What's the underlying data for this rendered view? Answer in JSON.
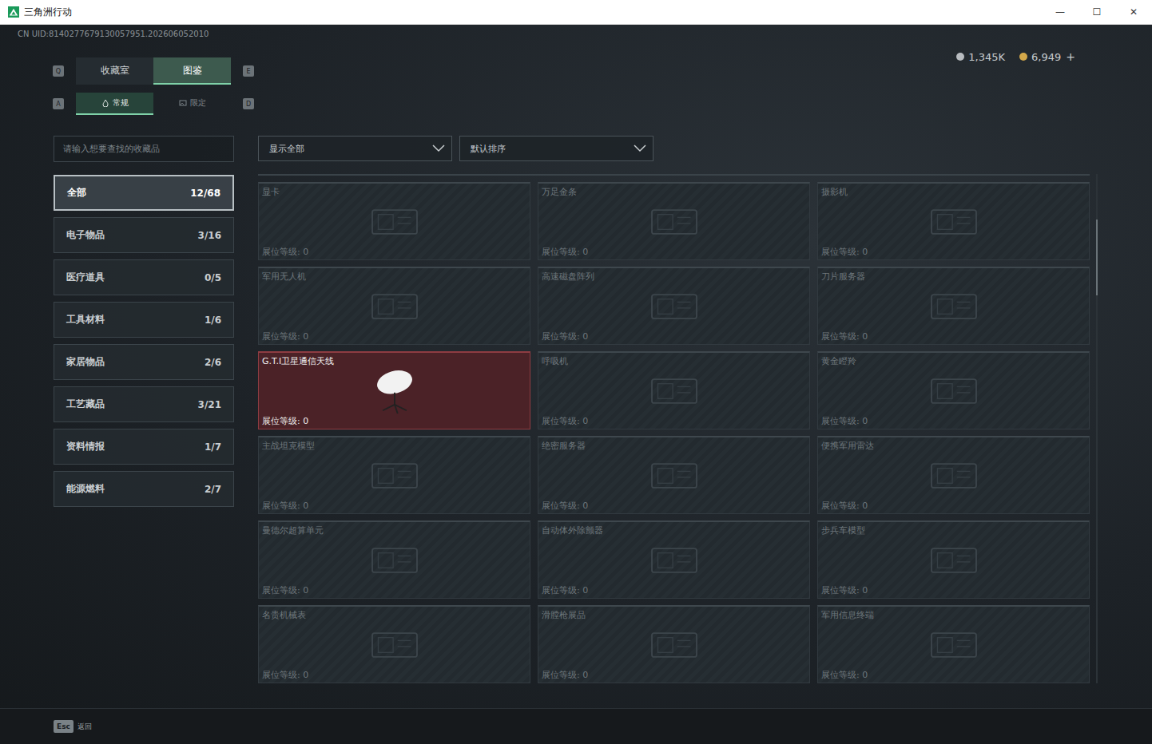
{
  "window": {
    "title": "三角洲行动",
    "controls": [
      "—",
      "☐",
      "✕"
    ]
  },
  "uid": "CN UID:8140277679130057951.202606052010",
  "currencies": [
    {
      "amount": "1,345K",
      "color": "#b8bcc0"
    },
    {
      "amount": "6,949",
      "color": "#d4a84a"
    }
  ],
  "add_button": "+",
  "main_tabs": {
    "prev_key": "Q",
    "next_key": "E",
    "items": [
      {
        "label": "收藏室",
        "selected": false
      },
      {
        "label": "图鉴",
        "selected": true
      }
    ]
  },
  "sub_tabs": {
    "prev_key": "A",
    "next_key": "D",
    "items": [
      {
        "label": "常规",
        "selected": true
      },
      {
        "label": "限定",
        "selected": false
      }
    ]
  },
  "search": {
    "placeholder": "请输入想要查找的收藏品"
  },
  "filters": [
    {
      "value": "显示全部"
    },
    {
      "value": "默认排序"
    }
  ],
  "categories": [
    {
      "label": "全部",
      "count": "12/68",
      "selected": true
    },
    {
      "label": "电子物品",
      "count": "3/16",
      "selected": false
    },
    {
      "label": "医疗道具",
      "count": "0/5",
      "selected": false
    },
    {
      "label": "工具材料",
      "count": "1/6",
      "selected": false
    },
    {
      "label": "家居物品",
      "count": "2/6",
      "selected": false
    },
    {
      "label": "工艺藏品",
      "count": "3/21",
      "selected": false
    },
    {
      "label": "资料情报",
      "count": "1/7",
      "selected": false
    },
    {
      "label": "能源燃料",
      "count": "2/7",
      "selected": false
    }
  ],
  "items": [
    {
      "name": "显卡",
      "level_text": "展位等级: 0",
      "owned": false
    },
    {
      "name": "万足金条",
      "level_text": "展位等级: 0",
      "owned": false
    },
    {
      "name": "摄影机",
      "level_text": "展位等级: 0",
      "owned": false
    },
    {
      "name": "军用无人机",
      "level_text": "展位等级: 0",
      "owned": false
    },
    {
      "name": "高速磁盘阵列",
      "level_text": "展位等级: 0",
      "owned": false
    },
    {
      "name": "刀片服务器",
      "level_text": "展位等级: 0",
      "owned": false
    },
    {
      "name": "G.T.I卫星通信天线",
      "level_text": "展位等级: 0",
      "owned": true
    },
    {
      "name": "呼吸机",
      "level_text": "展位等级: 0",
      "owned": false
    },
    {
      "name": "黄金瞪羚",
      "level_text": "展位等级: 0",
      "owned": false
    },
    {
      "name": "主战坦克模型",
      "level_text": "展位等级: 0",
      "owned": false
    },
    {
      "name": "绝密服务器",
      "level_text": "展位等级: 0",
      "owned": false
    },
    {
      "name": "便携军用雷达",
      "level_text": "展位等级: 0",
      "owned": false
    },
    {
      "name": "曼德尔超算单元",
      "level_text": "展位等级: 0",
      "owned": false
    },
    {
      "name": "自动体外除颤器",
      "level_text": "展位等级: 0",
      "owned": false
    },
    {
      "name": "步兵车模型",
      "level_text": "展位等级: 0",
      "owned": false
    },
    {
      "name": "名贵机械表",
      "level_text": "展位等级: 0",
      "owned": false
    },
    {
      "name": "滑膛枪展品",
      "level_text": "展位等级: 0",
      "owned": false
    },
    {
      "name": "军用信息终端",
      "level_text": "展位等级: 0",
      "owned": false
    }
  ],
  "footer": {
    "key": "Esc",
    "label": "返回"
  }
}
